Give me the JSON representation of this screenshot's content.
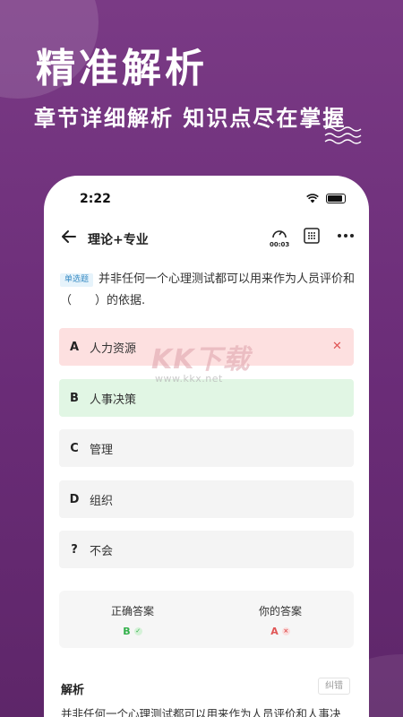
{
  "promo": {
    "headline": "精准解析",
    "subline": "章节详细解析  知识点尽在掌握"
  },
  "status_bar": {
    "time": "2:22"
  },
  "navbar": {
    "title": "理论+专业",
    "timer": "00:03"
  },
  "question": {
    "type_tag": "单选题",
    "text": "并非任何一个心理测试都可以用来作为人员评价和（　　）的依据."
  },
  "options": [
    {
      "letter": "A",
      "text": "人力资源",
      "state": "wrong"
    },
    {
      "letter": "B",
      "text": "人事决策",
      "state": "correct"
    },
    {
      "letter": "C",
      "text": "管理",
      "state": "normal"
    },
    {
      "letter": "D",
      "text": "组织",
      "state": "normal"
    },
    {
      "letter": "?",
      "text": "不会",
      "state": "normal"
    }
  ],
  "answers": {
    "correct_label": "正确答案",
    "correct_value": "B",
    "yours_label": "你的答案",
    "yours_value": "A"
  },
  "analysis": {
    "title": "解析",
    "report_label": "纠错",
    "text": "并非任何一个心理测试都可以用来作为人员评价和人事决"
  },
  "watermark": {
    "logo": "KK下载",
    "url": "www.kkx.net"
  },
  "colors": {
    "background": "#6c2f79",
    "wrong": "#fde0e0",
    "correct": "#e1f6e4",
    "wrong_mark": "#e05555",
    "correct_mark": "#32b04a",
    "tag_text": "#3a8cc4"
  }
}
